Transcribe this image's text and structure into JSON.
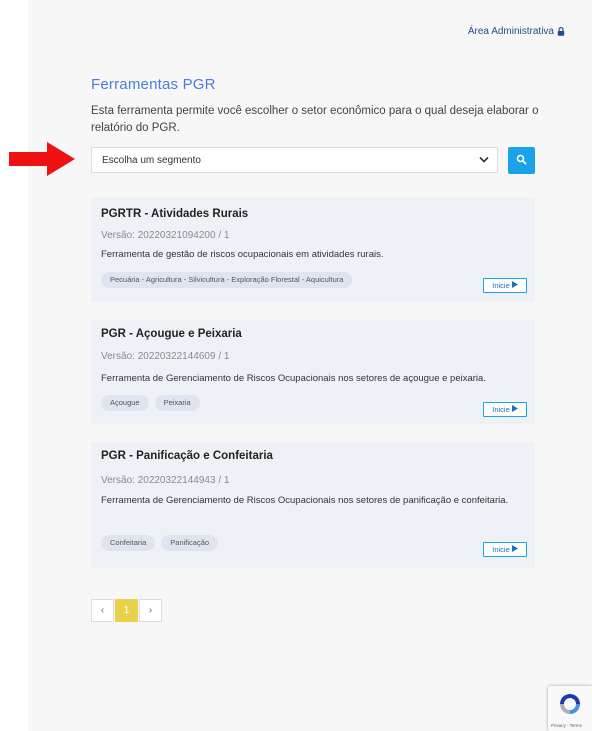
{
  "header": {
    "admin_link": "Área Administrativa"
  },
  "main": {
    "title": "Ferramentas PGR",
    "description": "Esta ferramenta permite você escolher o setor econômico para o qual deseja elaborar o relatório do PGR.",
    "segment_select": "Escolha um segmento"
  },
  "cards": [
    {
      "title": "PGRTR - Atividades Rurais",
      "version": "Versão: 20220321094200 / 1",
      "description": "Ferramenta de gestão de riscos ocupacionais em atividades rurais.",
      "tags": [
        "Pecuária - Agricultura - Silvicultura - Exploração Florestal - Aquicultura"
      ],
      "button": "Inicie"
    },
    {
      "title": "PGR - Açougue e Peixaria",
      "version": "Versão: 20220322144609 / 1",
      "description": "Ferramenta de Gerenciamento de Riscos Ocupacionais nos setores de açougue e peixaria.",
      "tags": [
        "Açougue",
        "Peixaria"
      ],
      "button": "Inicie"
    },
    {
      "title": "PGR - Panificação e Confeitaria",
      "version": "Versão: 20220322144943 / 1",
      "description": "Ferramenta de Gerenciamento de Riscos Ocupacionais nos setores de panificação e confeitaria.",
      "tags": [
        "Confeitaria",
        "Panificação"
      ],
      "button": "Inicie"
    }
  ],
  "pagination": {
    "prev": "‹",
    "current": "1",
    "next": "›"
  },
  "recaptcha": {
    "text": "Privacy - Terms"
  },
  "colors": {
    "accent": "#1aa3e8",
    "title": "#4a7fd6",
    "arrow": "#ee1111",
    "page_active": "#e8d24a"
  },
  "icons": {
    "lock": "lock-icon",
    "search": "search-icon",
    "chevron": "chevron-down-icon",
    "play": "play-icon",
    "arrow": "arrow-right-icon",
    "recaptcha": "recaptcha-icon"
  }
}
